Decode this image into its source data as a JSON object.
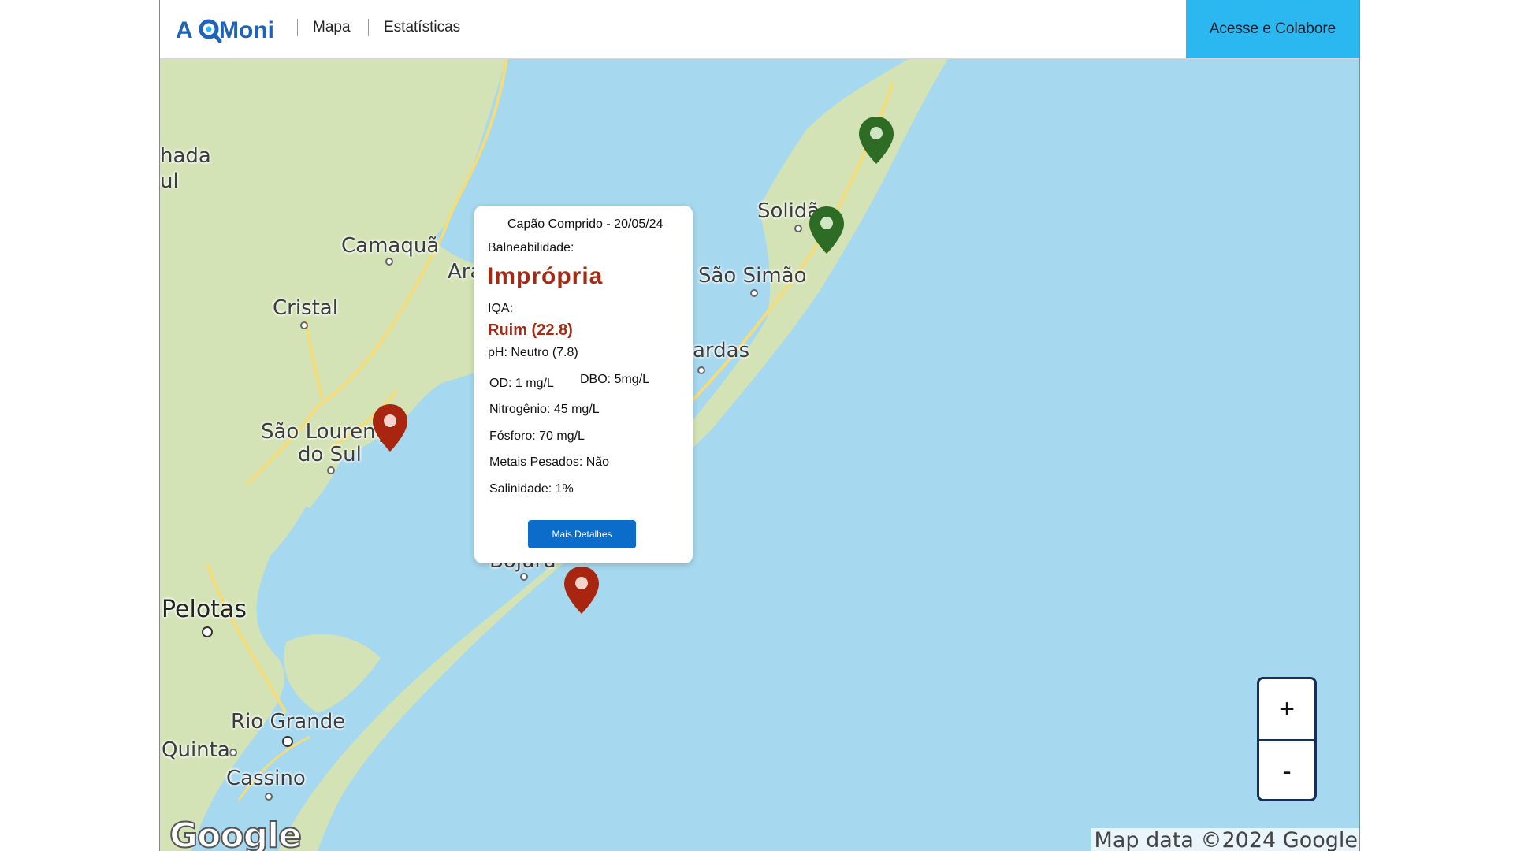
{
  "header": {
    "logo_text": "AQMoni",
    "nav": [
      "Mapa",
      "Estatísticas"
    ],
    "cta_label": "Acesse e Colabore"
  },
  "map": {
    "places": [
      "hada",
      "ul",
      "Camaquã",
      "Ara",
      "Cristal",
      "Solidã",
      "São Simão",
      "ardas",
      "São Lourenço",
      "do Sul",
      "Bojuru",
      "Pelotas",
      "Rio Grande",
      "Quinta",
      "Cassino"
    ],
    "pin_colors": {
      "good": "#2e6b24",
      "bad": "#a8260f"
    },
    "pins": [
      {
        "status": "good"
      },
      {
        "status": "good"
      },
      {
        "status": "bad"
      },
      {
        "status": "bad"
      }
    ],
    "google_logo": "Google",
    "attribution": "Map data ©2024 Google"
  },
  "popup": {
    "title": "Capão Comprido - 20/05/24",
    "balneabilidade_label": "Balneabilidade:",
    "balneabilidade_value": "Imprópria",
    "iqa_label": "IQA:",
    "iqa_value": "Ruim (22.8)",
    "ph": "pH: Neutro (7.8)",
    "od": "OD: 1 mg/L",
    "dbo": "DBO: 5mg/L",
    "nitrogenio": "Nitrogênio: 45 mg/L",
    "fosforo": "Fósforo: 70 mg/L",
    "metais": "Metais Pesados: Não",
    "salinidade": "Salinidade: 1%",
    "button_label": "Mais Detalhes"
  },
  "zoom": {
    "in": "+",
    "out": "-"
  }
}
